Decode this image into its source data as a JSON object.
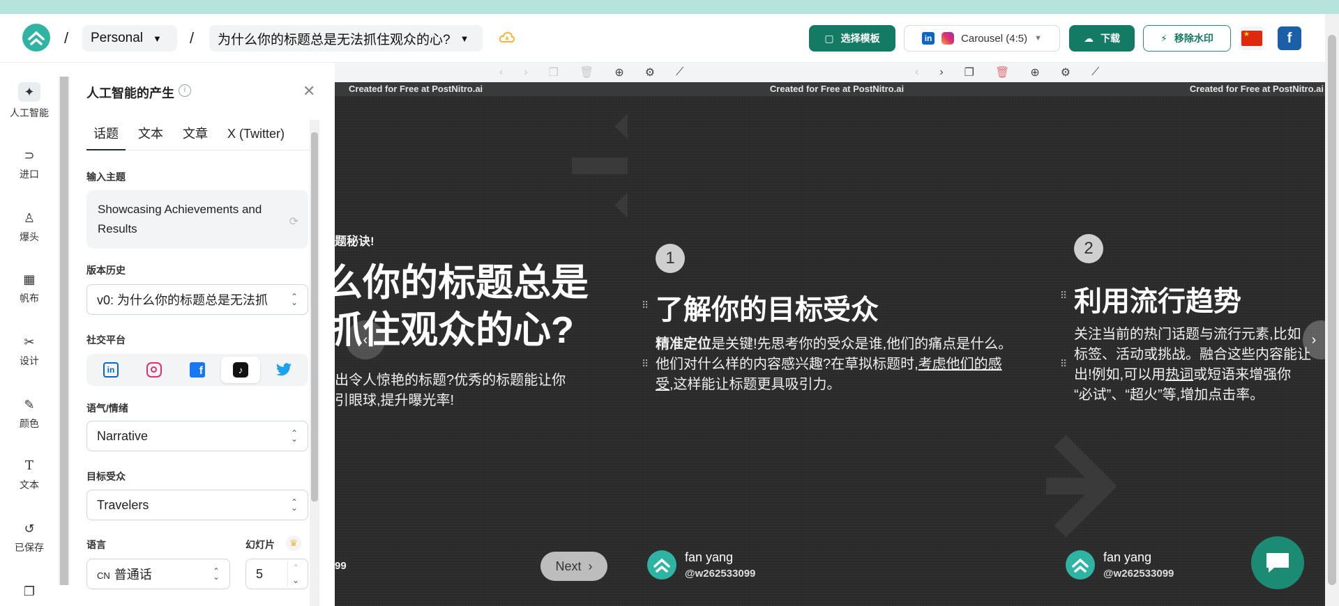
{
  "header": {
    "workspace": "Personal",
    "project_title": "为什么你的标题总是无法抓住观众的心?",
    "template_button": "选择模板",
    "platform_label": "Carousel (4:5)",
    "download_button": "下载",
    "remove_watermark_button": "移除水印",
    "fb_letter": "f"
  },
  "rail": {
    "items": [
      {
        "label": "人工智能",
        "icon": "sparkle-icon"
      },
      {
        "label": "进口",
        "icon": "import-icon"
      },
      {
        "label": "爆头",
        "icon": "headshot-icon"
      },
      {
        "label": "帆布",
        "icon": "canvas-icon"
      },
      {
        "label": "设计",
        "icon": "design-icon"
      },
      {
        "label": "颜色",
        "icon": "color-icon"
      },
      {
        "label": "文本",
        "icon": "text-icon"
      },
      {
        "label": "已保存",
        "icon": "history-icon"
      }
    ]
  },
  "panel": {
    "title": "人工智能的产生",
    "tabs": [
      "话题",
      "文本",
      "文章",
      "X (Twitter)"
    ],
    "topic_label": "输入主题",
    "topic_value": "Showcasing Achievements and Results",
    "history_label": "版本历史",
    "history_value": "v0: 为什么你的标题总是无法抓",
    "social_label": "社交平台",
    "tone_label": "语气/情绪",
    "tone_value": "Narrative",
    "audience_label": "目标受众",
    "audience_value": "Travelers",
    "language_label": "语言",
    "language_value": "普通话",
    "language_code": "CN",
    "slides_label": "幻灯片",
    "slides_value": "5"
  },
  "canvas": {
    "watermark": "Created for Free at PostNitro.ai",
    "slide0": {
      "kicker": "题秘诀!",
      "title_line1": "么你的标题总是",
      "title_line2": "抓住观众的心?",
      "body_line1": "出令人惊艳的标题?优秀的标题能让你",
      "body_line2": "引眼球,提升曝光率!",
      "handle_tail": "99",
      "next_label": "Next"
    },
    "slide1": {
      "number": "1",
      "title": "了解你的目标受众",
      "body_bold": "精准定位",
      "body_1": "是关键!先思考你的受众是谁,他们的痛点是什么。他们对什么样的内容感兴趣?在草拟标题时,",
      "body_underline": "考虑他们的感受",
      "body_2": ",这样能让标题更具吸引力。"
    },
    "slide2": {
      "number": "2",
      "title": "利用流行趋势",
      "body_1": "关注当前的热门话题与流行元素,比如",
      "body_2": "标签、活动或挑战。融合这些内容能让",
      "body_3a": "出!例如,可以用",
      "body_3u": "热词",
      "body_3b": "或短语来增强你",
      "body_4": "“必试”、“超火”等,增加点击率。"
    },
    "author": {
      "name": "fan yang",
      "handle": "@w262533099"
    }
  },
  "colors": {
    "brand": "#2fb4a3",
    "primary_button": "#137a64",
    "slide_bg": "#2b2b2b"
  }
}
